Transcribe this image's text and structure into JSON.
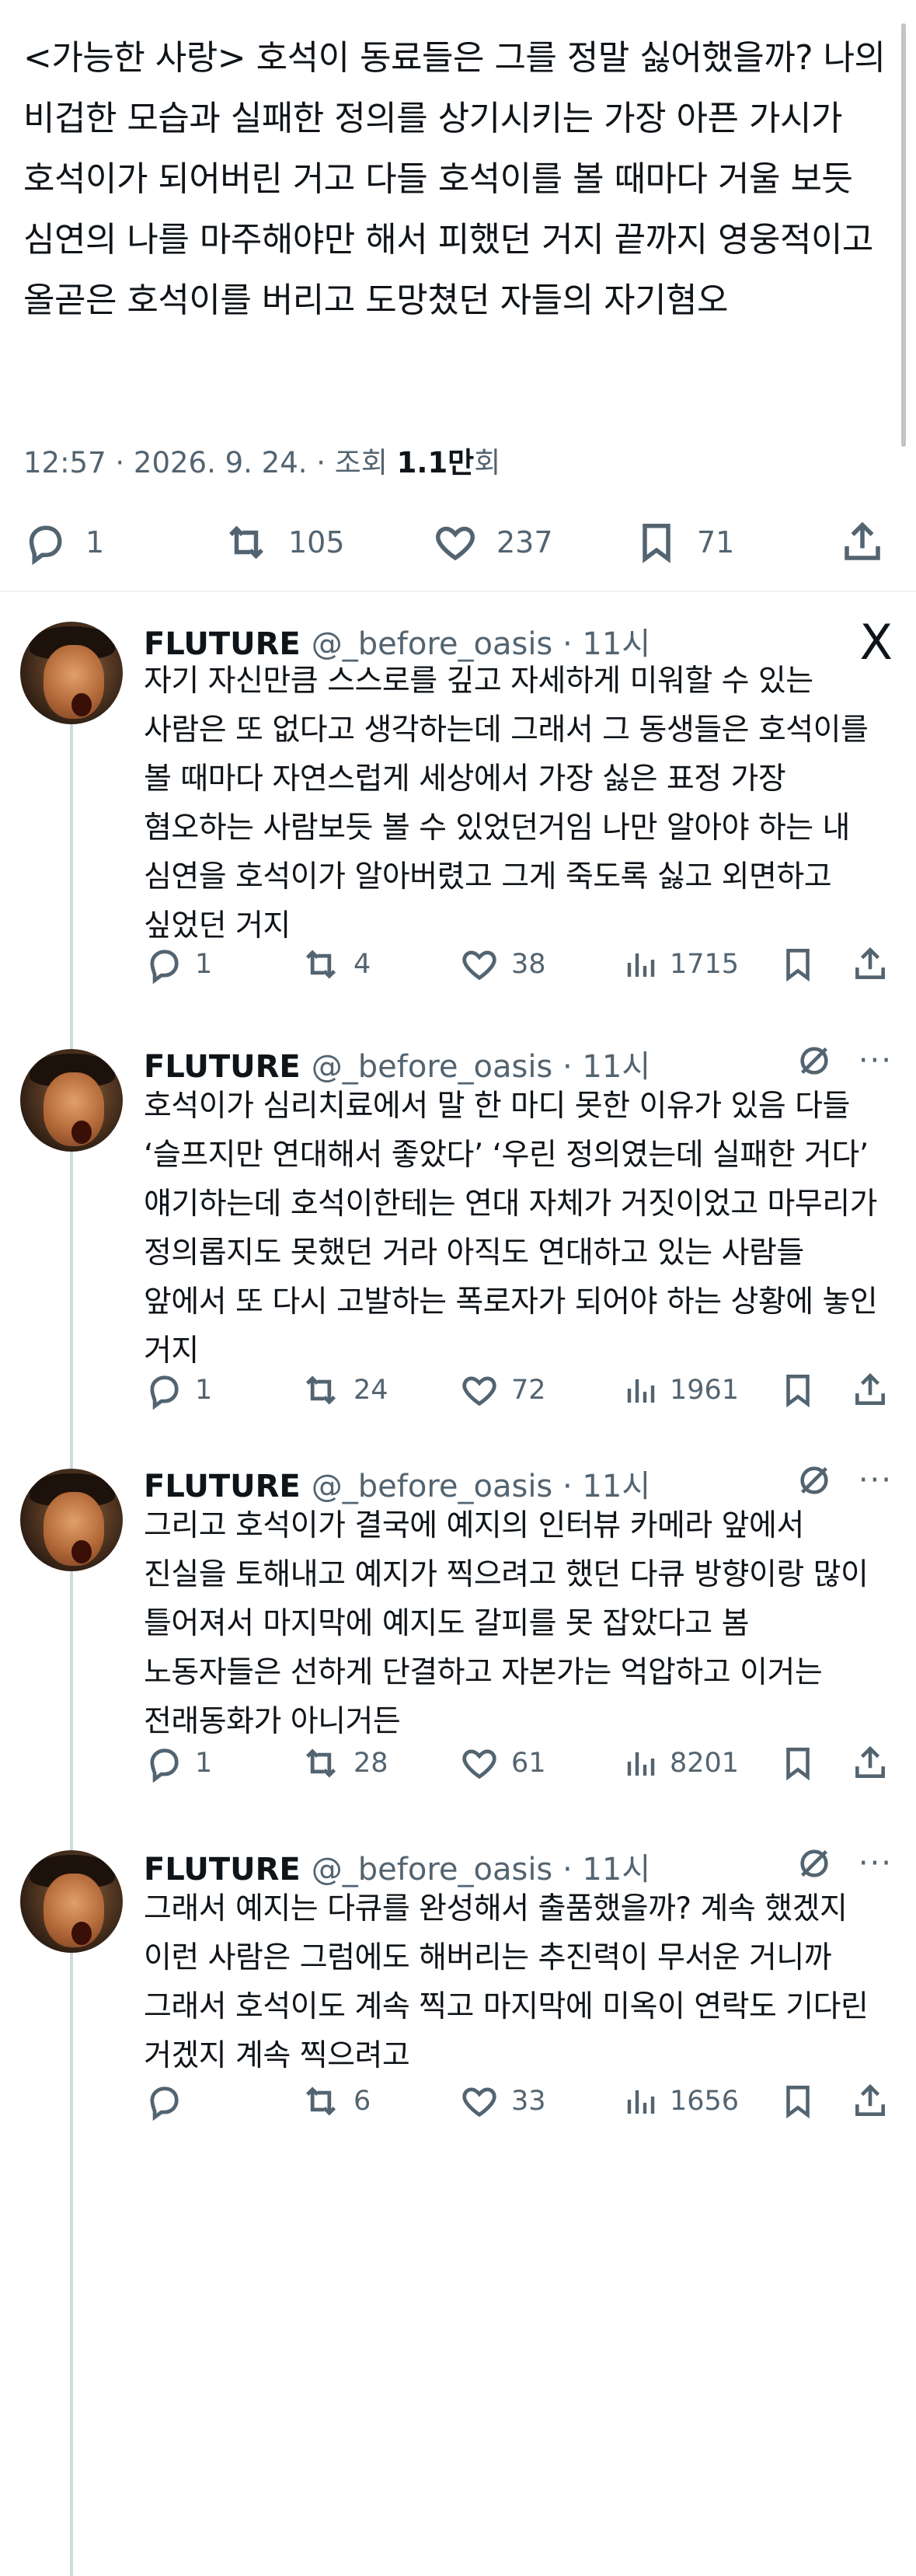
{
  "main": {
    "text": "<가능한 사랑> 호석이 동료들은 그를 정말 싫어했을까? 나의 비겁한 모습과 실패한 정의를 상기시키는 가장 아픈 가시가 호석이가 되어버린 거고 다들 호석이를 볼 때마다 거울 보듯 심연의 나를 마주해야만 해서 피했던 거지 끝까지 영웅적이고 올곧은 호석이를 버리고 도망쳤던 자들의 자기혐오",
    "meta_time": "12:57 · 2026. 9. 24. · 조회 ",
    "meta_views": "1.1만",
    "meta_suffix": "회",
    "replies": "1",
    "retweets": "105",
    "likes": "237",
    "bookmarks": "71"
  },
  "replies": [
    {
      "name": "FLUTURE",
      "handle": "@_before_oasis · 11시",
      "text": "자기 자신만큼 스스로를 깊고 자세하게 미워할 수 있는 사람은 또 없다고 생각하는데 그래서 그 동생들은 호석이를 볼 때마다 자연스럽게 세상에서 가장 싫은 표정 가장 혐오하는 사람보듯 볼 수 있었던거임 나만 알아야 하는 내 심연을 호석이가 알아버렸고 그게 죽도록 싫고 외면하고 싶었던 거지",
      "replies": "1",
      "retweets": "4",
      "likes": "38",
      "views": "1715",
      "corner": "X"
    },
    {
      "name": "FLUTURE",
      "handle": "@_before_oasis · 11시",
      "text": "호석이가 심리치료에서 말 한 마디 못한 이유가 있음 다들 ‘슬프지만 연대해서 좋았다’ ‘우린 정의였는데 실패한 거다’ 얘기하는데 호석이한테는 연대 자체가 거짓이었고 마무리가 정의롭지도 못했던 거라 아직도 연대하고 있는 사람들 앞에서 또 다시 고발하는 폭로자가 되어야 하는 상황에 놓인 거지",
      "replies": "1",
      "retweets": "24",
      "likes": "72",
      "views": "1961",
      "corner": ""
    },
    {
      "name": "FLUTURE",
      "handle": "@_before_oasis · 11시",
      "text": "그리고 호석이가 결국에 예지의 인터뷰 카메라 앞에서 진실을 토해내고 예지가 찍으려고 했던 다큐 방향이랑 많이 틀어져서 마지막에 예지도 갈피를 못 잡았다고 봄 노동자들은 선하게 단결하고 자본가는 억압하고 이거는 전래동화가 아니거든",
      "replies": "1",
      "retweets": "28",
      "likes": "61",
      "views": "8201",
      "corner": ""
    },
    {
      "name": "FLUTURE",
      "handle": "@_before_oasis · 11시",
      "text": "그래서 예지는 다큐를 완성해서 출품했을까? 계속 했겠지 이런 사람은 그럼에도 해버리는 추진력이 무서운 거니까 그래서 호석이도 계속 찍고 마지막에 미옥이 연락도 기다린 거겠지 계속 찍으려고",
      "replies": "",
      "retweets": "6",
      "likes": "33",
      "views": "1656",
      "corner": ""
    }
  ]
}
